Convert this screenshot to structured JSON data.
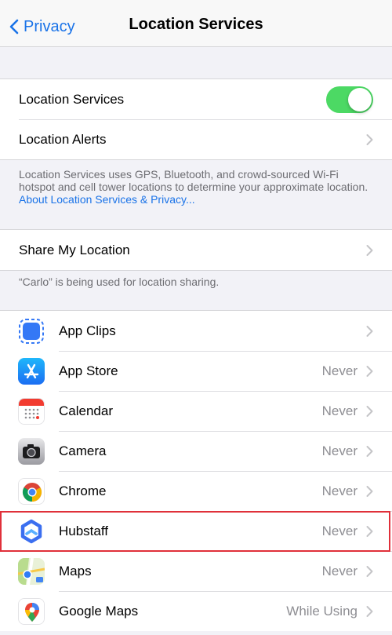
{
  "nav": {
    "back_label": "Privacy",
    "title": "Location Services"
  },
  "location_services": {
    "label": "Location Services",
    "enabled": true
  },
  "location_alerts": {
    "label": "Location Alerts"
  },
  "info_footer": {
    "text": "Location Services uses GPS, Bluetooth, and crowd-sourced Wi-Fi hotspot and cell tower locations to determine your approximate location. ",
    "link": "About Location Services & Privacy..."
  },
  "share_my_location": {
    "label": "Share My Location"
  },
  "share_footer": {
    "text": "“Carlo” is being used for location sharing."
  },
  "apps": [
    {
      "name": "App Clips",
      "value": "",
      "icon": "app-clips-icon"
    },
    {
      "name": "App Store",
      "value": "Never",
      "icon": "app-store-icon"
    },
    {
      "name": "Calendar",
      "value": "Never",
      "icon": "calendar-icon"
    },
    {
      "name": "Camera",
      "value": "Never",
      "icon": "camera-icon"
    },
    {
      "name": "Chrome",
      "value": "Never",
      "icon": "chrome-icon"
    },
    {
      "name": "Hubstaff",
      "value": "Never",
      "icon": "hubstaff-icon",
      "highlighted": true
    },
    {
      "name": "Maps",
      "value": "Never",
      "icon": "maps-icon"
    },
    {
      "name": "Google Maps",
      "value": "While Using",
      "icon": "google-maps-icon"
    }
  ],
  "colors": {
    "accent": "#1a73e8",
    "toggle_on": "#4cd964",
    "highlight": "#e0303a"
  }
}
